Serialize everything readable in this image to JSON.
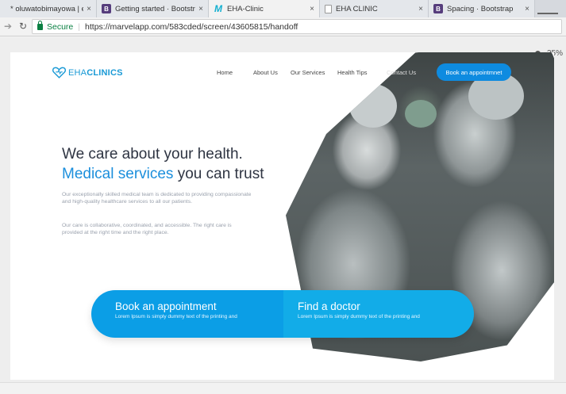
{
  "browser": {
    "tabs": [
      {
        "title": "* oluwatobimayowa | eHe",
        "icon": "blank-icon",
        "active": false
      },
      {
        "title": "Getting started · Bootstrap",
        "icon": "bootstrap-icon",
        "active": false
      },
      {
        "title": "EHA-Clinic",
        "icon": "marvel-icon",
        "active": true
      },
      {
        "title": "EHA CLINIC",
        "icon": "document-icon",
        "active": false
      },
      {
        "title": "Spacing · Bootstrap",
        "icon": "bootstrap-icon",
        "active": false
      }
    ],
    "tab_close_glyph": "×",
    "bootstrap_glyph": "B",
    "marvel_glyph": "M",
    "secure_label": "Secure",
    "url": "https://marvelapp.com/583cded/screen/43605815/handoff",
    "zoom": "35%"
  },
  "site": {
    "logo": {
      "light": "EHA",
      "bold": "CLINICS",
      "brand_color": "#1a9ad6"
    },
    "nav": [
      "Home",
      "About Us",
      "Our Services",
      "Health Tips",
      "Contact Us"
    ],
    "nav_cta": "Book an appointmnet",
    "headline_1": "We care about your health.",
    "headline_2_highlight": "Medical services",
    "headline_2_rest": " you can trust",
    "para_1": "Our exceptionally skilled medical team is dedicated to providing compassionate and high-quality healthcare services to all our patients.",
    "para_2": "Our care is collaborative, coordinated, and accessible. The right care is provided at the right time and the right place.",
    "band": {
      "left_title": "Book an appointment",
      "left_sub": "Lorem Ipsum is simply dummy text of the printing and",
      "right_title": "Find a doctor",
      "right_sub": "Lorem Ipsum is simply dummy text of the printing and"
    },
    "colors": {
      "accent": "#0e8be0",
      "band_left": "#0b9ee6",
      "band_right": "#12ace8",
      "text": "#2e3442"
    }
  }
}
